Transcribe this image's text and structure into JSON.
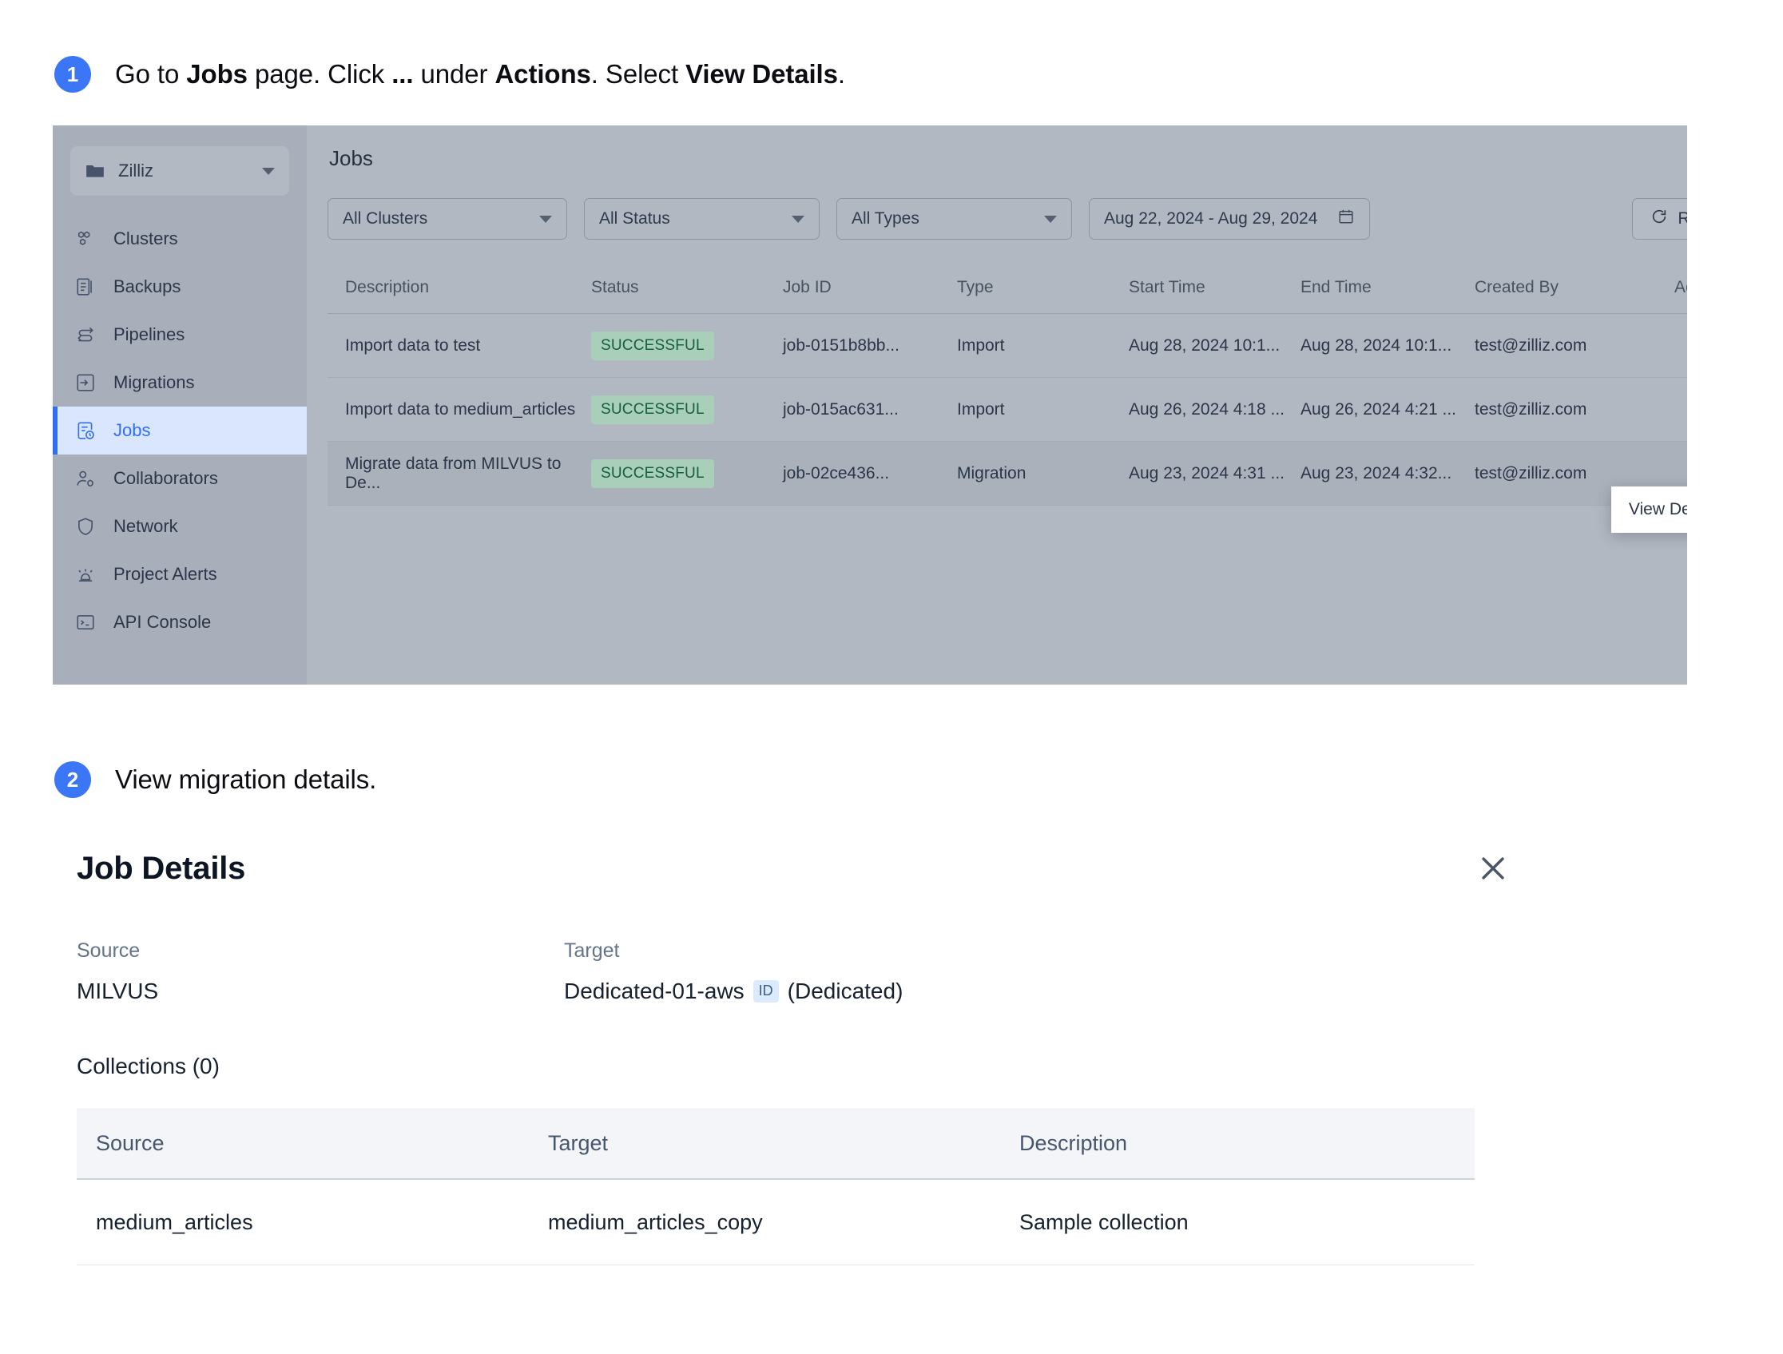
{
  "steps": [
    {
      "number": "1",
      "parts": [
        {
          "t": "Go to ",
          "b": false
        },
        {
          "t": "Jobs",
          "b": true
        },
        {
          "t": " page. Click ",
          "b": false
        },
        {
          "t": "...",
          "b": true
        },
        {
          "t": " under ",
          "b": false
        },
        {
          "t": "Actions",
          "b": true
        },
        {
          "t": ". Select ",
          "b": false
        },
        {
          "t": "View Details",
          "b": true
        },
        {
          "t": ".",
          "b": false
        }
      ]
    },
    {
      "number": "2",
      "parts": [
        {
          "t": "View migration details.",
          "b": false
        }
      ]
    }
  ],
  "app": {
    "sidebar": {
      "org": {
        "label": "Zilliz",
        "icon": "folder-icon",
        "caret": "chevron-down-icon"
      },
      "items": [
        {
          "label": "Clusters",
          "icon": "clusters-icon",
          "active": false
        },
        {
          "label": "Backups",
          "icon": "backups-icon",
          "active": false
        },
        {
          "label": "Pipelines",
          "icon": "pipelines-icon",
          "active": false
        },
        {
          "label": "Migrations",
          "icon": "migrations-icon",
          "active": false
        },
        {
          "label": "Jobs",
          "icon": "jobs-icon",
          "active": true
        },
        {
          "label": "Collaborators",
          "icon": "collaborators-icon",
          "active": false
        },
        {
          "label": "Network",
          "icon": "shield-icon",
          "active": false
        },
        {
          "label": "Project Alerts",
          "icon": "alert-icon",
          "active": false
        },
        {
          "label": "API Console",
          "icon": "terminal-icon",
          "active": false
        }
      ]
    },
    "page_title": "Jobs",
    "filters": {
      "clusters": "All Clusters",
      "status": "All Status",
      "types": "All Types",
      "date_range": "Aug 22, 2024 - Aug 29, 2024",
      "refresh": "Refresh"
    },
    "table": {
      "headers": {
        "description": "Description",
        "status": "Status",
        "job_id": "Job ID",
        "type": "Type",
        "start_time": "Start Time",
        "end_time": "End Time",
        "created_by": "Created By",
        "actions": "Actions"
      },
      "rows": [
        {
          "description": "Import data to test",
          "status": "SUCCESSFUL",
          "job_id": "job-0151b8bb...",
          "type": "Import",
          "start_time": "Aug 28, 2024 10:1...",
          "end_time": "Aug 28, 2024 10:1...",
          "created_by": "test@zilliz.com",
          "selected": false
        },
        {
          "description": "Import data to medium_articles",
          "status": "SUCCESSFUL",
          "job_id": "job-015ac631...",
          "type": "Import",
          "start_time": "Aug 26, 2024 4:18 ...",
          "end_time": "Aug 26, 2024 4:21 ...",
          "created_by": "test@zilliz.com",
          "selected": false
        },
        {
          "description": "Migrate data from MILVUS to De...",
          "status": "SUCCESSFUL",
          "job_id": "job-02ce436...",
          "type": "Migration",
          "start_time": "Aug 23, 2024 4:31 ...",
          "end_time": "Aug 23, 2024 4:32...",
          "created_by": "test@zilliz.com",
          "selected": true
        }
      ]
    },
    "context_menu": {
      "items": [
        "View Details"
      ]
    }
  },
  "job_details": {
    "title": "Job Details",
    "close_icon": "close-icon",
    "source_label": "Source",
    "source_value": "MILVUS",
    "target_label": "Target",
    "target_value": "Dedicated-01-aws",
    "target_chip": "ID",
    "target_suffix": "(Dedicated)",
    "collections_title": "Collections (0)",
    "collections_table": {
      "headers": {
        "source": "Source",
        "target": "Target",
        "description": "Description"
      },
      "rows": [
        {
          "source": "medium_articles",
          "target": "medium_articles_copy",
          "description": "Sample collection"
        }
      ]
    }
  },
  "colors": {
    "accent": "#3b76f6",
    "nav_active_bg": "#d9e6fd",
    "nav_active_text": "#2f6ff0",
    "status_badge_bg": "#a9ceba",
    "status_badge_text": "#17603c",
    "panel_bg": "#b2b8c2",
    "sidebar_bg": "#a9afba",
    "id_chip_bg": "#dbeafe"
  }
}
